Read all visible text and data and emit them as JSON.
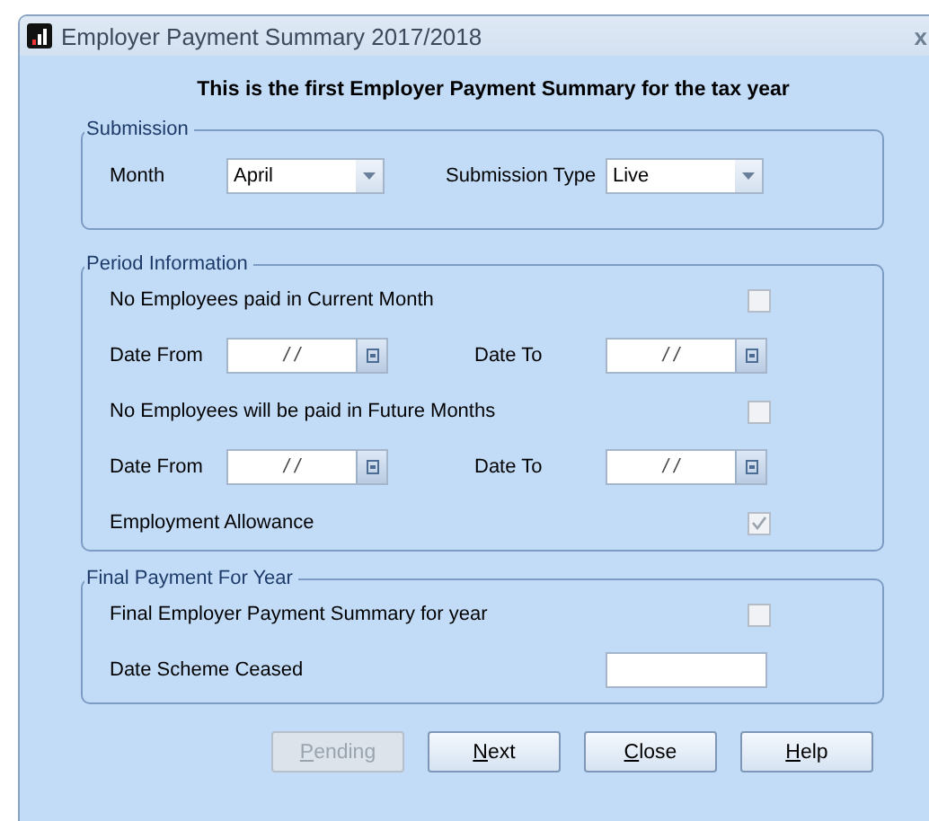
{
  "window": {
    "title": "Employer Payment Summary 2017/2018",
    "close": "x"
  },
  "heading": "This is the first Employer Payment Summary for the tax year",
  "submission": {
    "legend": "Submission",
    "month": {
      "label": "Month",
      "value": "April"
    },
    "submission_type": {
      "label": "Submission Type",
      "value": "Live"
    }
  },
  "period_information": {
    "legend": "Period Information",
    "rows": [
      {
        "kind": "checkbox",
        "label": "No Employees paid in Current Month",
        "checked": false
      },
      {
        "kind": "dates",
        "from": {
          "label": "Date From",
          "value": "/ /"
        },
        "to": {
          "label": "Date To",
          "value": "/ /"
        }
      },
      {
        "kind": "checkbox",
        "label": "No Employees will be paid in Future Months",
        "checked": false
      },
      {
        "kind": "dates",
        "from": {
          "label": "Date From",
          "value": "/ /"
        },
        "to": {
          "label": "Date To",
          "value": "/ /"
        }
      },
      {
        "kind": "checkbox",
        "label": "Employment Allowance",
        "checked": true
      }
    ]
  },
  "final_payment": {
    "legend": "Final Payment For Year",
    "rows": [
      {
        "kind": "checkbox",
        "label": "Final Employer Payment Summary for year",
        "checked": false
      },
      {
        "kind": "field",
        "label": "Date Scheme Ceased"
      }
    ]
  },
  "buttons": [
    {
      "label": "Pending",
      "disabled": true
    },
    {
      "label": "Next",
      "disabled": false
    },
    {
      "label": "Close",
      "disabled": false
    },
    {
      "label": "Help",
      "disabled": false
    }
  ]
}
